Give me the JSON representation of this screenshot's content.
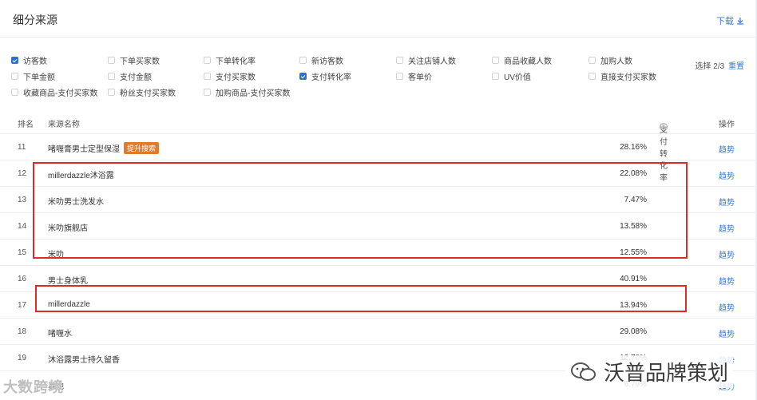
{
  "header": {
    "title": "细分来源",
    "download": "下载"
  },
  "filters": [
    {
      "label": "访客数",
      "checked": true
    },
    {
      "label": "下单买家数",
      "checked": false
    },
    {
      "label": "下单转化率",
      "checked": false
    },
    {
      "label": "新访客数",
      "checked": false
    },
    {
      "label": "关注店铺人数",
      "checked": false
    },
    {
      "label": "商品收藏人数",
      "checked": false
    },
    {
      "label": "加购人数",
      "checked": false
    },
    {
      "label": "下单金额",
      "checked": false
    },
    {
      "label": "支付金额",
      "checked": false
    },
    {
      "label": "支付买家数",
      "checked": false
    },
    {
      "label": "支付转化率",
      "checked": true
    },
    {
      "label": "客单价",
      "checked": false
    },
    {
      "label": "UV价值",
      "checked": false
    },
    {
      "label": "直接支付买家数",
      "checked": false
    },
    {
      "label": "收藏商品-支付买家数",
      "checked": false
    },
    {
      "label": "粉丝支付买家数",
      "checked": false
    },
    {
      "label": "加购商品-支付买家数",
      "checked": false
    }
  ],
  "selection": {
    "text": "选择 2/3",
    "reset": "重置"
  },
  "table": {
    "headers": {
      "rank": "排名",
      "name": "来源名称",
      "rate": "支付转化率",
      "op": "操作"
    },
    "rows": [
      {
        "rank": "11",
        "name": "啫喱膏男士定型保湿",
        "tag": "提升搜索",
        "rate": "28.16%",
        "op": "趋势"
      },
      {
        "rank": "12",
        "name": "millerdazzle沐浴露",
        "rate": "22.08%",
        "op": "趋势"
      },
      {
        "rank": "13",
        "name": "米叻男士洗发水",
        "rate": "7.47%",
        "op": "趋势"
      },
      {
        "rank": "14",
        "name": "米叻旗舰店",
        "rate": "13.58%",
        "op": "趋势"
      },
      {
        "rank": "15",
        "name": "米叻",
        "rate": "12.55%",
        "op": "趋势"
      },
      {
        "rank": "16",
        "name": "男士身体乳",
        "rate": "40.91%",
        "op": "趋势"
      },
      {
        "rank": "17",
        "name": "millerdazzle",
        "rate": "13.94%",
        "op": "趋势"
      },
      {
        "rank": "18",
        "name": "啫喱水",
        "rate": "29.08%",
        "op": "趋势"
      },
      {
        "rank": "19",
        "name": "沐浴露男士持久留香",
        "rate": "12.70%",
        "op": "趋势"
      },
      {
        "rank": "20",
        "name": "其他",
        "rate": "6.79%",
        "op": "趋势"
      }
    ]
  },
  "watermarks": {
    "left": "大数跨境",
    "right": "沃普品牌策划"
  },
  "colors": {
    "accent": "#3a7ad5",
    "highlight": "#e02a2a",
    "tag": "#e07b2b"
  }
}
